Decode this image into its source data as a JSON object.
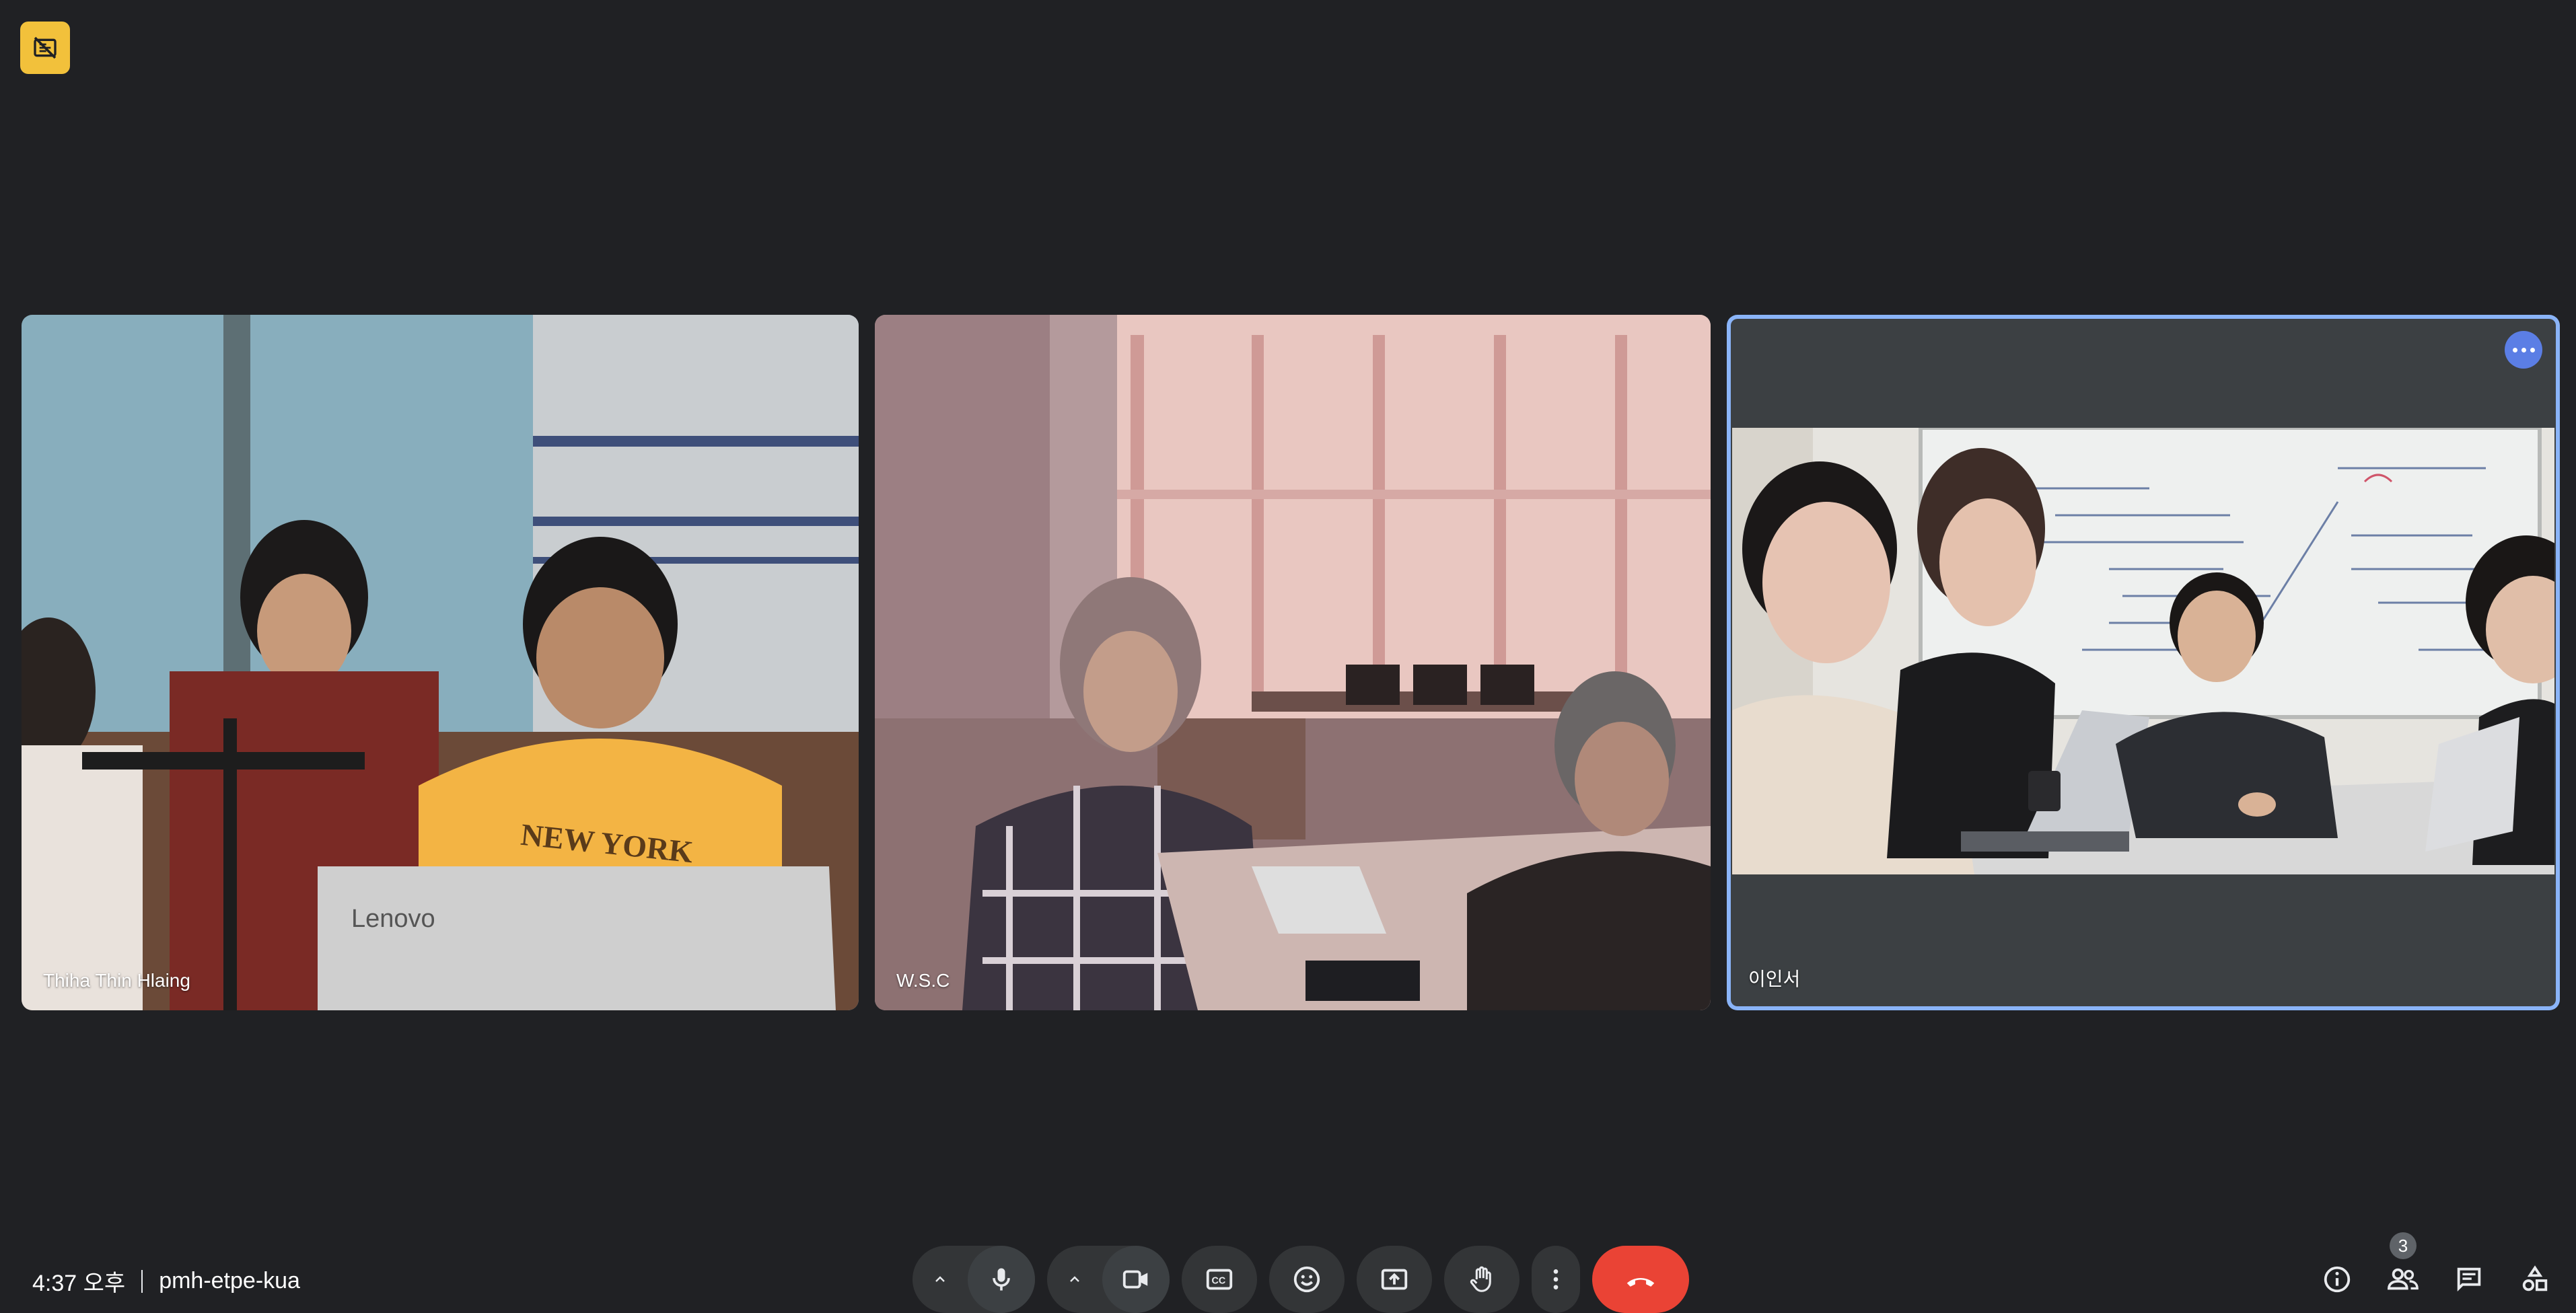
{
  "meeting": {
    "time": "4:37 오후",
    "code": "pmh-etpe-kua"
  },
  "participants": [
    {
      "name": "Thiha Thin Hlaing"
    },
    {
      "name": "W.S.C"
    },
    {
      "name": "이인서",
      "active": true
    }
  ],
  "laptop_brand": "Lenovo",
  "shirt_text": "NEW YORK",
  "toolbar": {
    "participant_count": "3",
    "icons": [
      "mic-options-chevron-icon",
      "microphone-icon",
      "camera-options-chevron-icon",
      "video-camera-icon",
      "captions-icon",
      "emoji-icon",
      "present-screen-icon",
      "raise-hand-icon",
      "more-options-icon",
      "hang-up-icon",
      "info-icon",
      "people-icon",
      "chat-icon",
      "activities-icon"
    ]
  },
  "colors": {
    "background": "#202124",
    "active_border": "#8ab4f8",
    "hangup": "#ea4335",
    "badge": "#f2c13b"
  }
}
